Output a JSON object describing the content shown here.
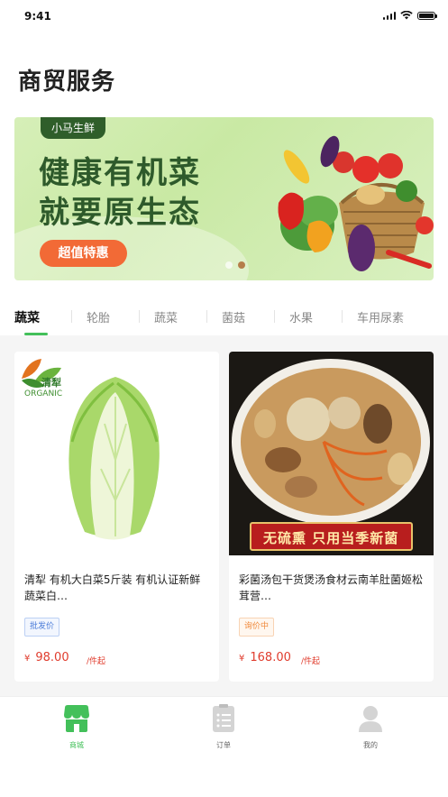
{
  "status_bar": {
    "time": "9:41"
  },
  "page": {
    "title": "商贸服务"
  },
  "banner": {
    "tag": "小马生鲜",
    "headline_line1": "健康有机菜",
    "headline_line2": "就要原生态",
    "cta": "超值特惠",
    "slide_count": 2,
    "active_slide": 2
  },
  "category_tabs": [
    {
      "label": "蔬菜",
      "active": true
    },
    {
      "label": "轮胎",
      "active": false
    },
    {
      "label": "蔬菜",
      "active": false
    },
    {
      "label": "菌菇",
      "active": false
    },
    {
      "label": "水果",
      "active": false
    },
    {
      "label": "车用尿素",
      "active": false
    }
  ],
  "products": [
    {
      "logo_text": "清犁",
      "logo_subtext": "ORGANIC",
      "title": "清犁 有机大白菜5斤装 有机认证新鲜蔬菜白…",
      "badge": "批发价",
      "currency": "¥",
      "price": "98.00",
      "unit": "/件起"
    },
    {
      "image_caption": "无硫熏 只用当季新菌",
      "title": "彩菌汤包干货煲汤食材云南羊肚菌姬松茸营…",
      "badge": "询价中",
      "currency": "¥",
      "price": "168.00",
      "unit": "/件起"
    }
  ],
  "tabbar": [
    {
      "label": "商城",
      "icon": "store-icon",
      "active": true
    },
    {
      "label": "订单",
      "icon": "order-list-icon",
      "active": false
    },
    {
      "label": "我的",
      "icon": "user-icon",
      "active": false
    }
  ],
  "colors": {
    "accent_green": "#43c05a",
    "price_red": "#e03c2d",
    "cta_orange": "#f26a36",
    "banner_dark_green": "#2e5a2b"
  }
}
